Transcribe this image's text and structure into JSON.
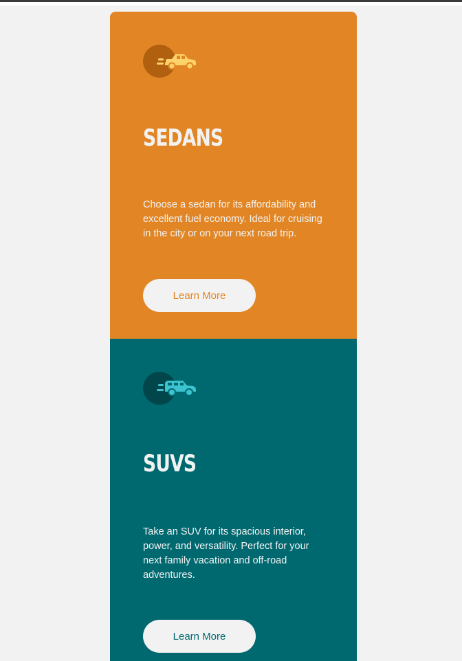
{
  "theme": {
    "page_bg": "#f2f2f2",
    "sedan_color": "#e28625",
    "suv_color": "#006970",
    "text_light": "#f2f2f2"
  },
  "cards": [
    {
      "icon": "sedan-car-icon",
      "title": "SEDANS",
      "description": "Choose a sedan for its affordability and excellent fuel economy. Ideal for cruising in the city or on your next road trip.",
      "button_label": "Learn More"
    },
    {
      "icon": "suv-car-icon",
      "title": "SUVS",
      "description": "Take an SUV for its spacious interior, power, and versatility. Perfect for your next family vacation and off-road adventures.",
      "button_label": "Learn More"
    }
  ]
}
